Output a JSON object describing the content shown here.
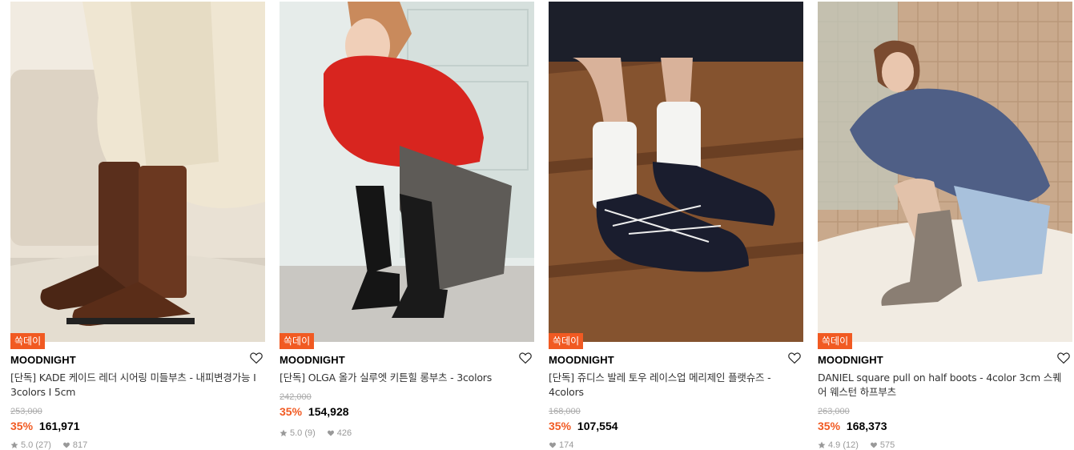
{
  "products": [
    {
      "badge": "쏙데이",
      "brand": "MOODNIGHT",
      "name": "[단독] KADE 케이드 레더 시어링 미들부츠 - 내피변경가능 I 3colors I 5cm",
      "original_price": "253,000",
      "discount": "35%",
      "price": "161,971",
      "rating": "5.0 (27)",
      "likes": "817"
    },
    {
      "badge": "쏙데이",
      "brand": "MOODNIGHT",
      "name": "[단독] OLGA 올가 실루엣 키튼힐 롱부츠 - 3colors",
      "original_price": "242,000",
      "discount": "35%",
      "price": "154,928",
      "rating": "5.0 (9)",
      "likes": "426"
    },
    {
      "badge": "쏙데이",
      "brand": "MOODNIGHT",
      "name": "[단독] 쥬디스 발레 토우 레이스업 메리제인 플랫슈즈 - 4colors",
      "original_price": "168,000",
      "discount": "35%",
      "price": "107,554",
      "rating": "",
      "likes": "174"
    },
    {
      "badge": "쏙데이",
      "brand": "MOODNIGHT",
      "name": "DANIEL square pull on half boots - 4color 3cm 스퀘어 웨스턴 하프부츠",
      "original_price": "263,000",
      "discount": "35%",
      "price": "168,373",
      "rating": "4.9 (12)",
      "likes": "575"
    }
  ],
  "icons": {
    "wishlist": "heart-outline-icon",
    "rating": "star-icon",
    "likes": "heart-filled-icon"
  },
  "colors": {
    "accent": "#f15a22",
    "strike": "#aaaaaa",
    "meta": "#999999"
  }
}
